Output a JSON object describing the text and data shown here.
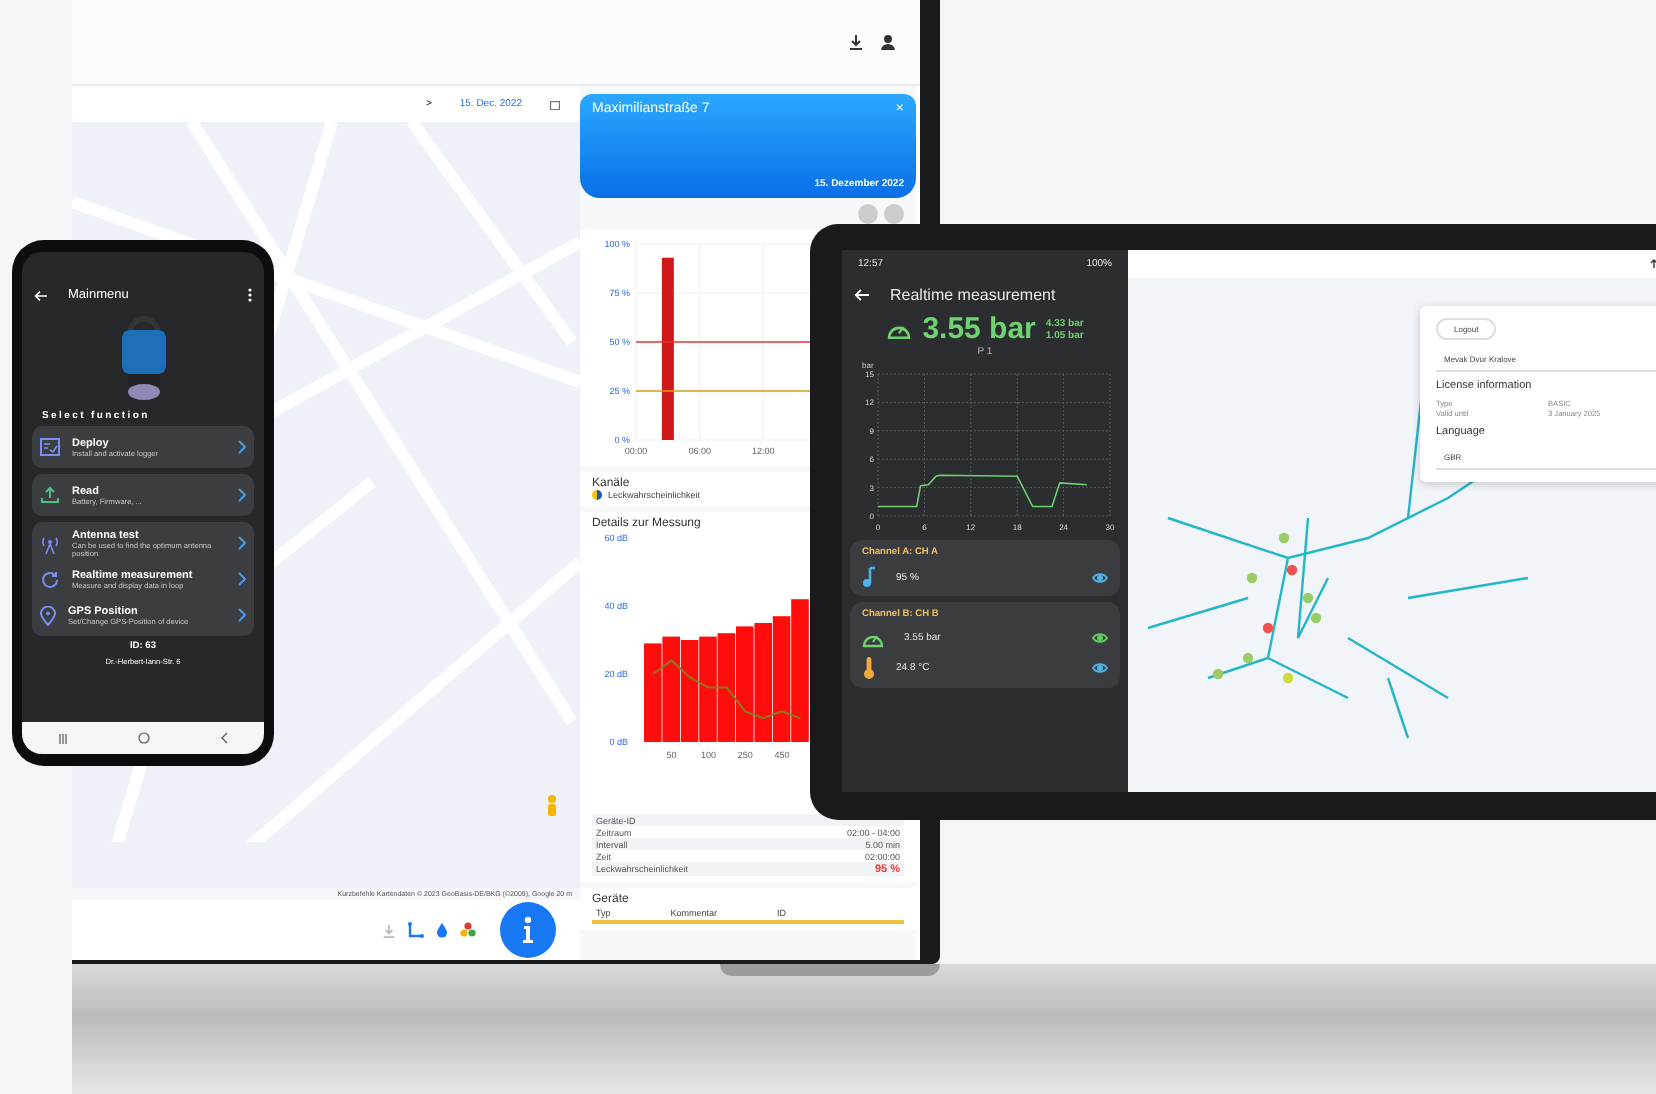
{
  "laptop": {
    "date_filter": {
      "arrow": ">",
      "date": "15. Dec. 2022"
    },
    "map_attribution": "Kurzbefehle   Kartendaten © 2023 GeoBasis-DE/BKG (©2009), Google   20 m",
    "detail_panel": {
      "title": "Maximilianstraße 7",
      "close": "×",
      "date": "15. Dezember 2022",
      "probability_chart": {
        "chart_data": {
          "type": "bar",
          "x": [
            3
          ],
          "values": [
            93
          ],
          "xlim": [
            0,
            26
          ],
          "ylim": [
            0,
            100
          ],
          "grid": true,
          "xticks": [
            {
              "value": 0,
              "label": "00:00"
            },
            {
              "value": 6,
              "label": "06:00"
            },
            {
              "value": 12,
              "label": "12:00"
            }
          ],
          "yticks": [
            {
              "value": 0,
              "label": "0 %"
            },
            {
              "value": 25,
              "label": "25 %"
            },
            {
              "value": 50,
              "label": "50 %"
            },
            {
              "value": 75,
              "label": "75 %"
            },
            {
              "value": 100,
              "label": "100 %"
            }
          ],
          "ref_lines": [
            {
              "value": 50,
              "axis": "y",
              "color": "#e53935"
            },
            {
              "value": 25,
              "axis": "y",
              "color": "#d4a017"
            }
          ]
        }
      },
      "channels_title": "Kanäle",
      "channels": [
        {
          "name": "Leckwahrscheinlichkeit"
        }
      ],
      "details_title": "Details zur Messung",
      "spectrum_chart": {
        "chart_data": {
          "type": "bar",
          "categories": [
            null,
            "50",
            null,
            "100",
            null,
            "250",
            null,
            "450",
            null
          ],
          "stacked": false,
          "ylim": [
            0,
            60
          ],
          "yticks": [
            {
              "value": 0,
              "label": "0 dB"
            },
            {
              "value": 20,
              "label": "20 dB"
            },
            {
              "value": 40,
              "label": "40 dB"
            },
            {
              "value": 60,
              "label": "60 dB"
            }
          ],
          "series": [
            {
              "type": "bar",
              "color": "#ff0d0d",
              "values": [
                29,
                31,
                30,
                31,
                32,
                34,
                35,
                37,
                42
              ]
            },
            {
              "type": "line",
              "color": "#8a7a1e",
              "values": [
                20,
                24,
                19,
                16,
                16,
                9,
                7,
                9,
                7
              ]
            }
          ]
        }
      },
      "details": [
        {
          "label": "Geräte-ID"
        },
        {
          "label": "Zeitraum",
          "value": "02:00 - 04:00"
        },
        {
          "label": "Intervall",
          "value": "5.00 min"
        },
        {
          "label": "Zeit",
          "value": "02:00:00"
        },
        {
          "label": "Leckwahrscheinlichkeit",
          "value": "95 %",
          "color": "#e53935"
        }
      ],
      "devices_title": "Geräte",
      "device_columns": [
        "Typ",
        "Kommentar",
        "ID"
      ]
    }
  },
  "phone": {
    "title": "Mainmenu",
    "section": "Select function",
    "menu_groups": [
      [
        {
          "title": "Deploy",
          "subtitle": "Install and activate logger",
          "kind": "deploy"
        }
      ],
      [
        {
          "title": "Read",
          "subtitle": "Battery, Firmware, ...",
          "kind": "read"
        }
      ],
      [
        {
          "title": "Antenna test",
          "subtitle": "Can be used to find the optimum antenna position",
          "kind": "antenna"
        },
        {
          "title": "Realtime measurement",
          "subtitle": "Measure and display data in loop",
          "kind": "realtime"
        },
        {
          "title": "GPS Position",
          "subtitle": "Set/Change GPS-Position of device",
          "kind": "gps"
        }
      ]
    ],
    "device_id": "ID: 63",
    "address": "Dr.-Herbert-Iann-Str. 6"
  },
  "tablet": {
    "status": {
      "time": "12:57",
      "battery": "100%"
    },
    "title": "Realtime measurement",
    "reading": "3.55 bar",
    "max": "4.33 bar",
    "min": "1.05 bar",
    "sensor": "P 1",
    "pressure_chart": {
      "chart_data": {
        "type": "line",
        "ylabel": "bar",
        "xlim": [
          0,
          30
        ],
        "ylim": [
          0,
          15
        ],
        "grid": true,
        "xticks": [
          0,
          6,
          12,
          18,
          24,
          30
        ],
        "yticks": [
          0,
          3,
          6,
          9,
          12,
          15
        ],
        "series": [
          {
            "color": "#6fd36f",
            "x": [
              0,
              5,
              5.5,
              6.5,
              7.5,
              8,
              18,
              20,
              22.5,
              23.5,
              27
            ],
            "values": [
              1,
              1,
              3.2,
              3.3,
              4.2,
              4.3,
              4.2,
              1,
              1,
              3.5,
              3.3
            ]
          }
        ]
      }
    },
    "channels": [
      {
        "title": "Channel A: CH A",
        "values": [
          {
            "kind": "note",
            "text": "95 %",
            "color": "#4fb3e8"
          }
        ]
      },
      {
        "title": "Channel B: CH B",
        "values": [
          {
            "kind": "gauge",
            "text": "3.55 bar",
            "color": "#5fcf5f"
          },
          {
            "kind": "thermo",
            "text": "24.8 °C",
            "color": "#4fb3e8"
          }
        ]
      }
    ],
    "account": {
      "logout": "Logout",
      "company": "Mevak Dvur Kralove",
      "license_title": "License information",
      "license": [
        {
          "label": "Type",
          "value": "BASIC"
        },
        {
          "label": "Valid until",
          "value": "3 January 2025"
        }
      ],
      "language_title": "Language",
      "language": "GBR"
    }
  }
}
